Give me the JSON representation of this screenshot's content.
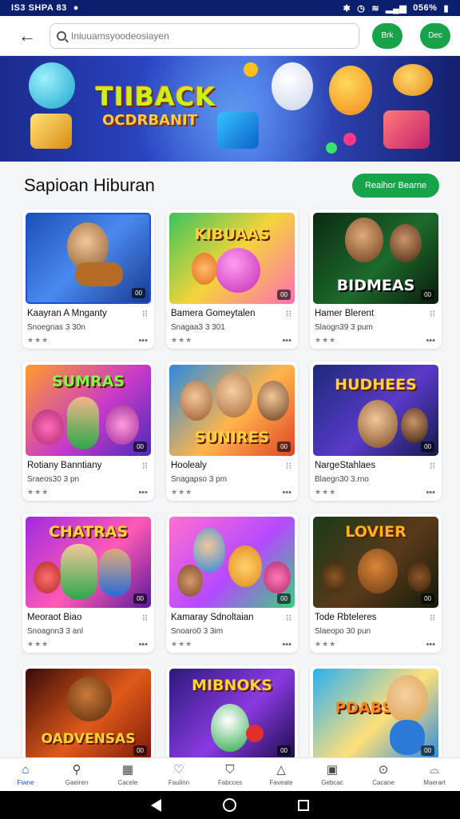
{
  "status_bar": {
    "left_text": "IS3 SHPA 83",
    "battery": "056%"
  },
  "search": {
    "placeholder": "Iniuuamsyoodeosiayen"
  },
  "header_buttons": [
    "Brk",
    "Dec"
  ],
  "banner": {
    "title": "TIIBACK",
    "subtitle": "OCDRBANIT"
  },
  "section": {
    "title": "Sapioan Hiburan",
    "more_label": "Reaihor Bearne"
  },
  "games": [
    {
      "name": "Kaayran A Mnganty",
      "sub": "Snoegnas 3 30n",
      "thumb_text": "",
      "badge": "00"
    },
    {
      "name": "Bamera Gomeytalen",
      "sub": "Snagaa3 3 301",
      "thumb_text": "KIBUAAS",
      "badge": "00"
    },
    {
      "name": "Hamer Blerent",
      "sub": "Slaogn39 3 pum",
      "thumb_text": "BIDMEAS",
      "badge": "00"
    },
    {
      "name": "Rotiany Banntiany",
      "sub": "Sraeos30 3 pn",
      "thumb_text": "SUMRAS",
      "badge": "00"
    },
    {
      "name": "Hoolealy",
      "sub": "Snagapso 3 pm",
      "thumb_text": "SUNIRES",
      "badge": "00"
    },
    {
      "name": "NargeStahlaes",
      "sub": "Blaegn30 3.rno",
      "thumb_text": "HUDHEES",
      "badge": "00"
    },
    {
      "name": "Meoraot Biao",
      "sub": "Snoagnn3 3 anl",
      "thumb_text": "CHATRAS",
      "badge": "00"
    },
    {
      "name": "Kamaray Sdnoltaian",
      "sub": "Snoaro0 3 3im",
      "thumb_text": "",
      "badge": "00"
    },
    {
      "name": "Tode Rbteleres",
      "sub": "Slaeopo 30 pun",
      "thumb_text": "LOVIER",
      "badge": "00"
    },
    {
      "name": "",
      "sub": "",
      "thumb_text": "OADVENSAS",
      "badge": "00"
    },
    {
      "name": "",
      "sub": "",
      "thumb_text": "MIBNOKS",
      "badge": "00"
    },
    {
      "name": "",
      "sub": "",
      "thumb_text": "PDABS",
      "badge": "00"
    }
  ],
  "bottom_nav": [
    {
      "label": "Fiwne",
      "icon": "home-icon"
    },
    {
      "label": "Gaeiren",
      "icon": "search-icon"
    },
    {
      "label": "Cacele",
      "icon": "grid-icon"
    },
    {
      "label": "Faulinn",
      "icon": "heart-icon"
    },
    {
      "label": "Fabcces",
      "icon": "shield-icon"
    },
    {
      "label": "Faveate",
      "icon": "bell-icon"
    },
    {
      "label": "Gebcac",
      "icon": "gallery-icon"
    },
    {
      "label": "Cacane",
      "icon": "circle-icon"
    },
    {
      "label": "Maerart",
      "icon": "user-icon"
    }
  ],
  "colors": {
    "accent": "#16a34a",
    "status_bar": "#0b1f6e",
    "active_nav": "#1d4ed8"
  }
}
